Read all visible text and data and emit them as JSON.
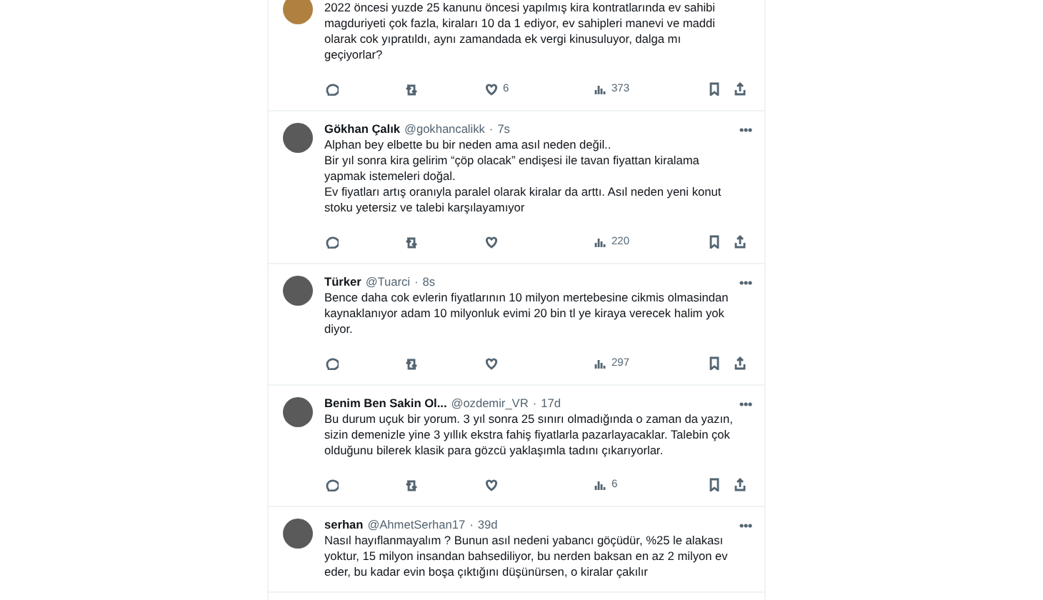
{
  "tweets": [
    {
      "text": "2022 öncesi  yuzde 25 kanunu öncesi yapılmış kira kontratlarında ev sahibi magduriyeti çok fazla, kiraları 10 da 1 ediyor, ev sahipleri manevi ve maddi olarak cok yıpratıldı, aynı zamandada ek  vergi kinusuluyor, dalga mı geçiyorlar?",
      "likes": "6",
      "views": "373"
    },
    {
      "name": "Gökhan Çalık",
      "handle": "@gokhancalikk",
      "sep": "·",
      "time": "7s",
      "text": "Alphan bey elbette bu bir neden ama asıl neden değil..\nBir yıl sonra kira gelirim “çöp olacak” endişesi ile tavan fiyattan kiralama yapmak istemeleri doğal.\nEv fiyatları artış oranıyla paralel olarak kiralar da arttı. Asıl neden yeni konut stoku yetersiz ve talebi karşılayamıyor",
      "views": "220"
    },
    {
      "name": "Türker",
      "handle": "@Tuarci",
      "sep": "·",
      "time": "8s",
      "text": "Bence daha cok evlerin fiyatlarının 10 milyon mertebesine cikmis olmasindan kaynaklanıyor adam 10 milyonluk evimi 20 bin tl ye kiraya verecek halim yok diyor.",
      "views": "297"
    },
    {
      "name": "Benim Ben Sakin Ol...",
      "handle": "@ozdemir_VR",
      "sep": "·",
      "time": "17d",
      "text": "Bu durum uçuk bir yorum. 3 yıl sonra 25 sınırı olmadığında o zaman da yazın, sizin demenizle yine 3 yıllık ekstra fahiş fiyatlarla pazarlayacaklar. Talebin çok olduğunu bilerek klasik para gözcü yaklaşımla tadını çıkarıyorlar.",
      "views": "6"
    },
    {
      "name": "serhan",
      "handle": "@AhmetSerhan17",
      "sep": "·",
      "time": "39d",
      "text": "Nasıl hayıflanmayalım ? Bunun asıl nedeni yabancı göçüdür, %25 le alakası yoktur, 15 milyon insandan bahsediliyor, bu nerden baksan en az 2 milyon ev eder, bu kadar evin boşa çıktığını düşünürsen, o kiralar çakılır"
    }
  ]
}
